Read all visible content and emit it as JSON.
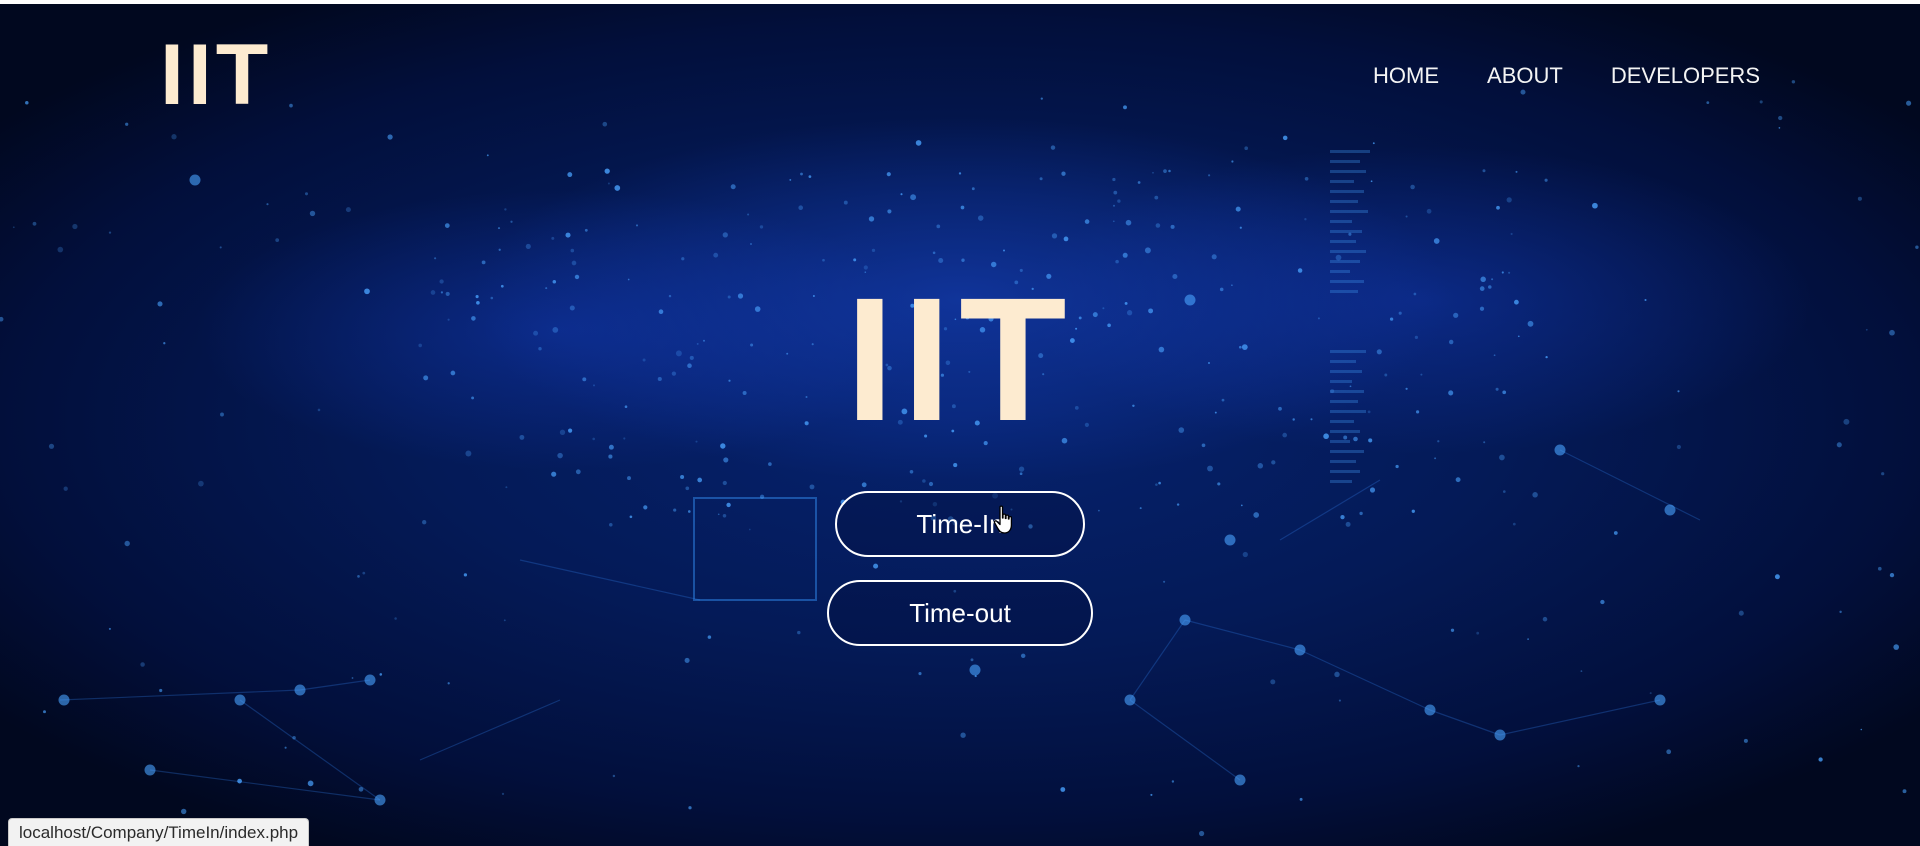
{
  "header": {
    "logo": "IIT",
    "nav": [
      "HOME",
      "ABOUT",
      "DEVELOPERS"
    ]
  },
  "hero": {
    "title": "IIT",
    "time_in_label": "Time-In",
    "time_out_label": "Time-out"
  },
  "status_bar": {
    "url": "localhost/Company/TimeIn/index.php"
  },
  "colors": {
    "background": "#041a57",
    "title": "#fdebd0",
    "button_border": "#ffffff",
    "particle": "#4aa3ff"
  },
  "icons": {
    "cursor": "hand-pointer-icon"
  }
}
